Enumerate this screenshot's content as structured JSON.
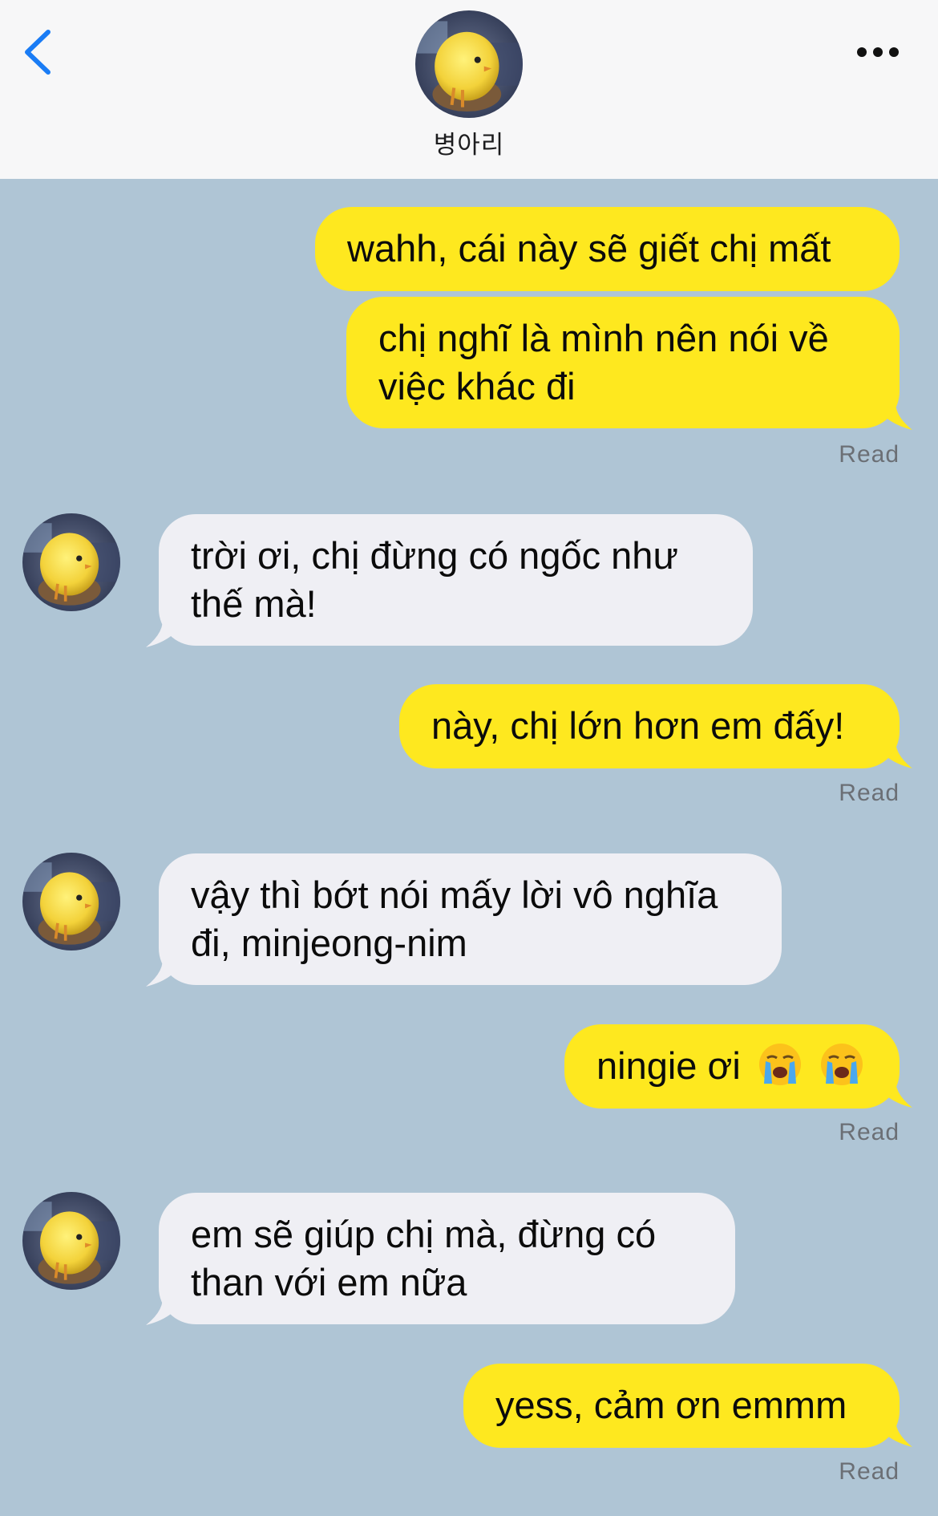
{
  "header": {
    "contact_name": "병아리",
    "back_icon": "chevron-left-icon",
    "more_icon": "ellipsis-icon",
    "accent": "#1a7cf5"
  },
  "colors": {
    "background": "#afc5d5",
    "outgoing_bubble": "#fee81f",
    "incoming_bubble": "#efeff4"
  },
  "messages": [
    {
      "direction": "out",
      "lines": [
        "wahh, cái này sẽ giết chị mất"
      ]
    },
    {
      "direction": "out",
      "lines": [
        "chị nghĩ là mình nên nói về",
        "việc khác đi"
      ],
      "status": "Read"
    },
    {
      "direction": "in",
      "lines": [
        "trời ơi, chị đừng có ngốc như",
        "thế mà!"
      ]
    },
    {
      "direction": "out",
      "lines": [
        "này, chị lớn hơn em đấy!"
      ],
      "status": "Read"
    },
    {
      "direction": "in",
      "lines": [
        "vậy thì bớt nói mấy lời vô nghĩa",
        "đi, minjeong-nim"
      ]
    },
    {
      "direction": "out",
      "lines": [
        "ningie ơi"
      ],
      "emoji": [
        "loudly-crying-face-icon",
        "loudly-crying-face-icon"
      ],
      "status": "Read"
    },
    {
      "direction": "in",
      "lines": [
        "em sẽ giúp chị mà, đừng có",
        "than với em nữa"
      ]
    },
    {
      "direction": "out",
      "lines": [
        "yess, cảm ơn emmm"
      ],
      "status": "Read"
    }
  ]
}
